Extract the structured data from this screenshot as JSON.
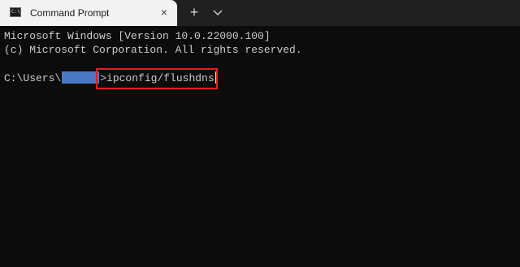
{
  "window": {
    "tab": {
      "title": "Command Prompt",
      "icon": "cmd-icon",
      "close_glyph": "×"
    },
    "new_tab_glyph": "+",
    "dropdown_icon": "chevron-down-icon"
  },
  "terminal": {
    "line1": "Microsoft Windows [Version 10.0.22000.100]",
    "line2": "(c) Microsoft Corporation. All rights reserved.",
    "prompt_prefix": "C:\\Users\\",
    "prompt_suffix": ">",
    "command": "ipconfig/flushdns",
    "highlight_color": "#e02020",
    "redaction_color": "#4a78c4"
  }
}
